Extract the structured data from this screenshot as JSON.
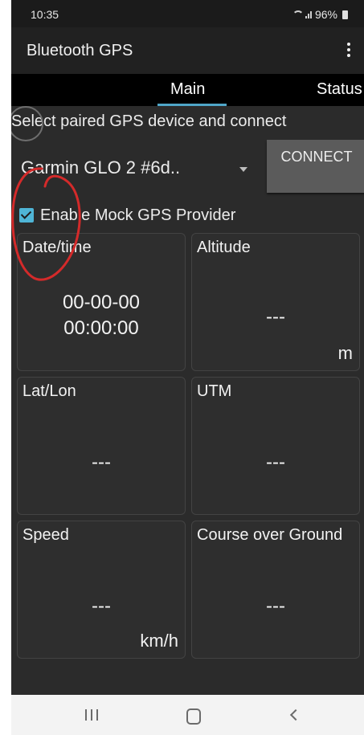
{
  "status_bar": {
    "time": "10:35",
    "battery": "96%"
  },
  "app_bar": {
    "title": "Bluetooth GPS",
    "menu_icon": "overflow-menu-icon"
  },
  "tabs": [
    {
      "label": "Main",
      "selected": true
    },
    {
      "label": "Status",
      "selected": false
    }
  ],
  "device_select": {
    "label": "Select paired GPS device and connect",
    "selected_device": "Garmin GLO 2 #6d..",
    "connect_label": "CONNECT"
  },
  "mock": {
    "label": "Enable Mock GPS Provider",
    "checked": true
  },
  "tiles": {
    "datetime": {
      "label": "Date/time",
      "value_line1": "00-00-00",
      "value_line2": "00:00:00"
    },
    "altitude": {
      "label": "Altitude",
      "value": "---",
      "unit": "m"
    },
    "latlon": {
      "label": "Lat/Lon",
      "value": "---"
    },
    "utm": {
      "label": "UTM",
      "value": "---"
    },
    "speed": {
      "label": "Speed",
      "value": "---",
      "unit": "km/h"
    },
    "course": {
      "label": "Course over Ground",
      "value": "---"
    }
  },
  "colors": {
    "accent": "#4fb5d6",
    "background": "#2b2b2b",
    "annotation": "#d42a2a"
  }
}
